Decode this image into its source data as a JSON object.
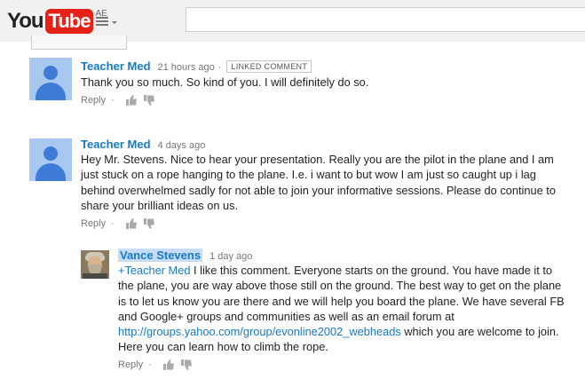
{
  "masthead": {
    "logo_you": "You",
    "logo_tube": "Tube",
    "country_code": "AE",
    "search_placeholder": ""
  },
  "comments": [
    {
      "author": "Teacher Med",
      "time": "21 hours ago",
      "badge": "LINKED COMMENT",
      "text": "Thank you so much. So kind of you. I will definitely do so.",
      "reply_label": "Reply"
    },
    {
      "author": "Teacher Med",
      "time": "4 days ago",
      "text": "Hey Mr. Stevens. Nice to hear your presentation. Really you are the pilot in the plane and I am just stuck on a rope hanging to the plane. I.e. i want to but wow I am just so caught up i lag behind overwhelmed sadly for not able to join your informative sessions. Please do continue to share your brilliant ideas on us.",
      "reply_label": "Reply"
    },
    {
      "author": "Vance Stevens",
      "time": "1 day ago",
      "mention": "+Teacher Med",
      "text_before_link": " I like this comment. Everyone starts on the ground. You have made it to the plane, you are way above those still on the ground. The best way to get on the plane is to let us know you are there and we will help you board the plane. We have several FB and Google+ groups and communities as well as an email forum at ",
      "link": "http://groups.yahoo.com/group/evonline2002_webheads",
      "text_after_link": " which you are welcome to join. Here you can learn how to climb the rope.",
      "reply_label": "Reply"
    }
  ],
  "colors": {
    "accent": "#167ac6",
    "logo_red": "#e62117",
    "masthead_bg": "#f1f1f1"
  }
}
